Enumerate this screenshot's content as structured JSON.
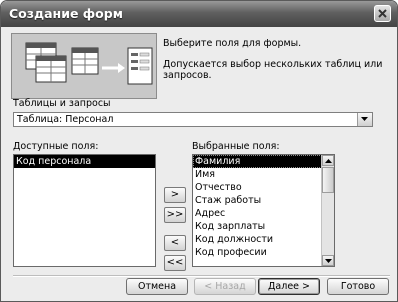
{
  "window": {
    "title": "Создание форм"
  },
  "intro": {
    "line1": "Выберите поля для формы.",
    "line2": "Допускается выбор нескольких таблиц или запросов."
  },
  "tables": {
    "label": "Таблицы и запросы",
    "selected": "Таблица: Персонал"
  },
  "available": {
    "label": "Доступные поля:",
    "items": [
      "Код персонала"
    ]
  },
  "chosen": {
    "label": "Выбранные поля:",
    "items": [
      "Фамилия",
      "Имя",
      "Отчество",
      "Стаж работы",
      "Адрес",
      "Код зарплаты",
      "Код должности",
      "Код професии"
    ]
  },
  "move_buttons": {
    "add_one": ">",
    "add_all": ">>",
    "remove_one": "<",
    "remove_all": "<<"
  },
  "footer": {
    "cancel": "Отмена",
    "back": "< Назад",
    "next": "Далее >",
    "finish": "Готово"
  }
}
